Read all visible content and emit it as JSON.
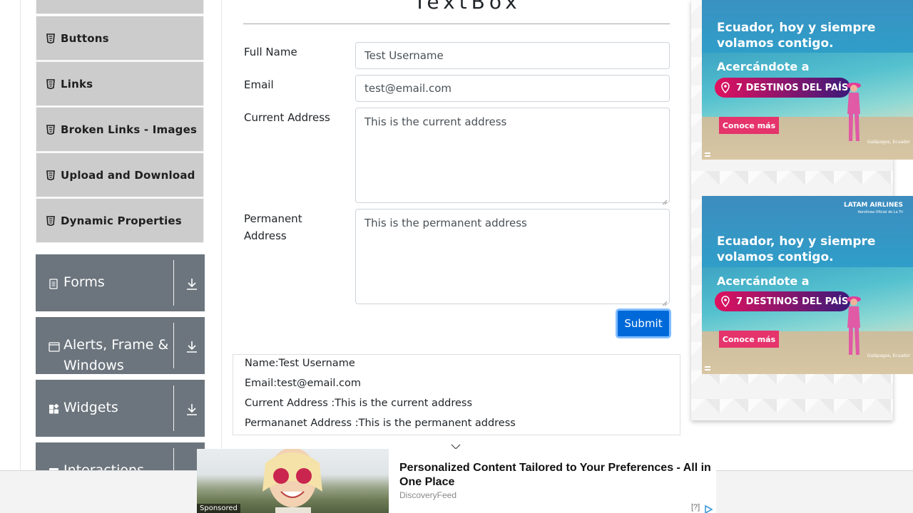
{
  "sidebar": {
    "sub_items": [
      {
        "label": "Buttons"
      },
      {
        "label": "Links"
      },
      {
        "label": "Broken Links - Images"
      },
      {
        "label": "Upload and Download"
      },
      {
        "label": "Dynamic Properties"
      }
    ],
    "groups": [
      {
        "title": "Forms",
        "icon": "document-icon"
      },
      {
        "title_line1": "Alerts, Frame &",
        "title_line2": "Windows",
        "icon": "window-icon"
      },
      {
        "title": "Widgets",
        "icon": "widgets-icon"
      },
      {
        "title": "Interactions",
        "icon": "interactions-icon"
      }
    ]
  },
  "form": {
    "heading": "TextBox",
    "full_name_label": "Full Name",
    "full_name_value": "Test Username",
    "email_label": "Email",
    "email_value": "test@email.com",
    "current_address_label": "Current Address",
    "current_address_value": "This is the current address",
    "permanent_address_label_line1": "Permanent",
    "permanent_address_label_line2": "Address",
    "permanent_address_value": "This is the permanent address",
    "submit_label": "Submit"
  },
  "output": {
    "name": "Name:Test Username",
    "email": "Email:test@email.com",
    "current_address": "Current Address :This is the current address",
    "permanent_address": "Permananet Address :This is the permanent address"
  },
  "ads": {
    "airline_brand": "LATAM AIRLINES",
    "airline_tagline": "Aerolínea Oficial de La Tri",
    "headline_line1": "Ecuador, hoy y siempre",
    "headline_line2": "volamos contigo.",
    "subline": "Acercándote a",
    "pill": "7 DESTINOS DEL PAÍS",
    "cta": "Conoce más",
    "location": "Galápagos, Ecuador"
  },
  "sponsored": {
    "tag": "Sponsored",
    "headline": "Personalized Content Tailored to Your Preferences - All in One Place",
    "source": "DiscoveryFeed",
    "adchoices_q": "[?]"
  },
  "colors": {
    "group_bg": "#6c757d",
    "sub_item_bg": "#cccccc",
    "submit_bg": "#0069d9",
    "submit_border": "#80bdff",
    "ad_pill": "#e0115f",
    "ad_cta": "#e5336b"
  }
}
